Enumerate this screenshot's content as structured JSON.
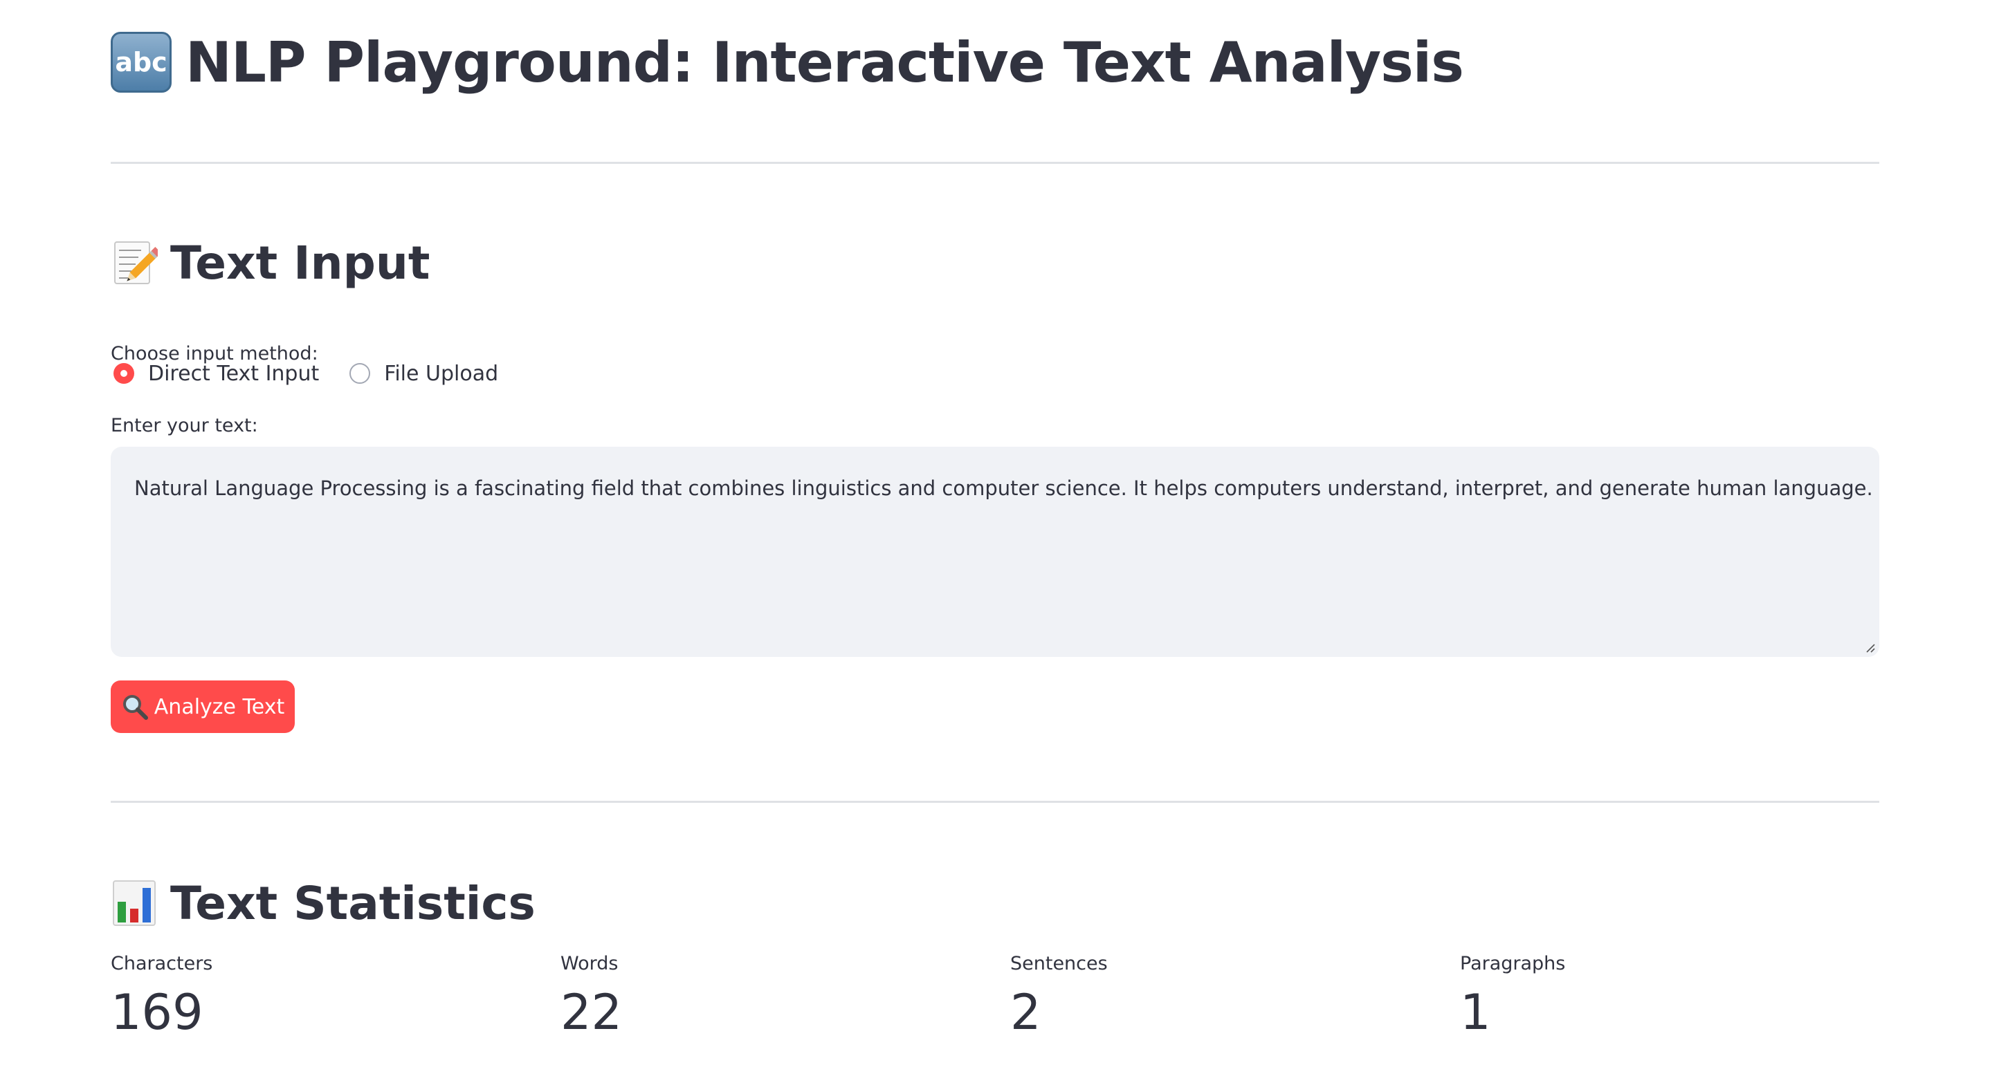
{
  "header": {
    "icon_text": "abc",
    "title": "NLP Playground: Interactive Text Analysis"
  },
  "text_input": {
    "heading": "Text Input",
    "heading_icon": "memo-icon",
    "input_method_label": "Choose input method:",
    "options": [
      {
        "label": "Direct Text Input",
        "selected": true
      },
      {
        "label": "File Upload",
        "selected": false
      }
    ],
    "text_label": "Enter your text:",
    "text_value": "Natural Language Processing is a fascinating field that combines linguistics and computer science. It helps computers understand, interpret, and generate human language.",
    "analyze_button_label": "Analyze Text",
    "analyze_button_icon": "magnifier-icon"
  },
  "statistics": {
    "heading": "Text Statistics",
    "heading_icon": "bar-chart-icon",
    "items": [
      {
        "label": "Characters",
        "value": "169"
      },
      {
        "label": "Words",
        "value": "22"
      },
      {
        "label": "Sentences",
        "value": "2"
      },
      {
        "label": "Paragraphs",
        "value": "1"
      }
    ]
  },
  "colors": {
    "accent": "#ff4b4b",
    "text": "#31333f",
    "input_bg": "#f0f2f6",
    "divider": "#dfe1e5"
  }
}
